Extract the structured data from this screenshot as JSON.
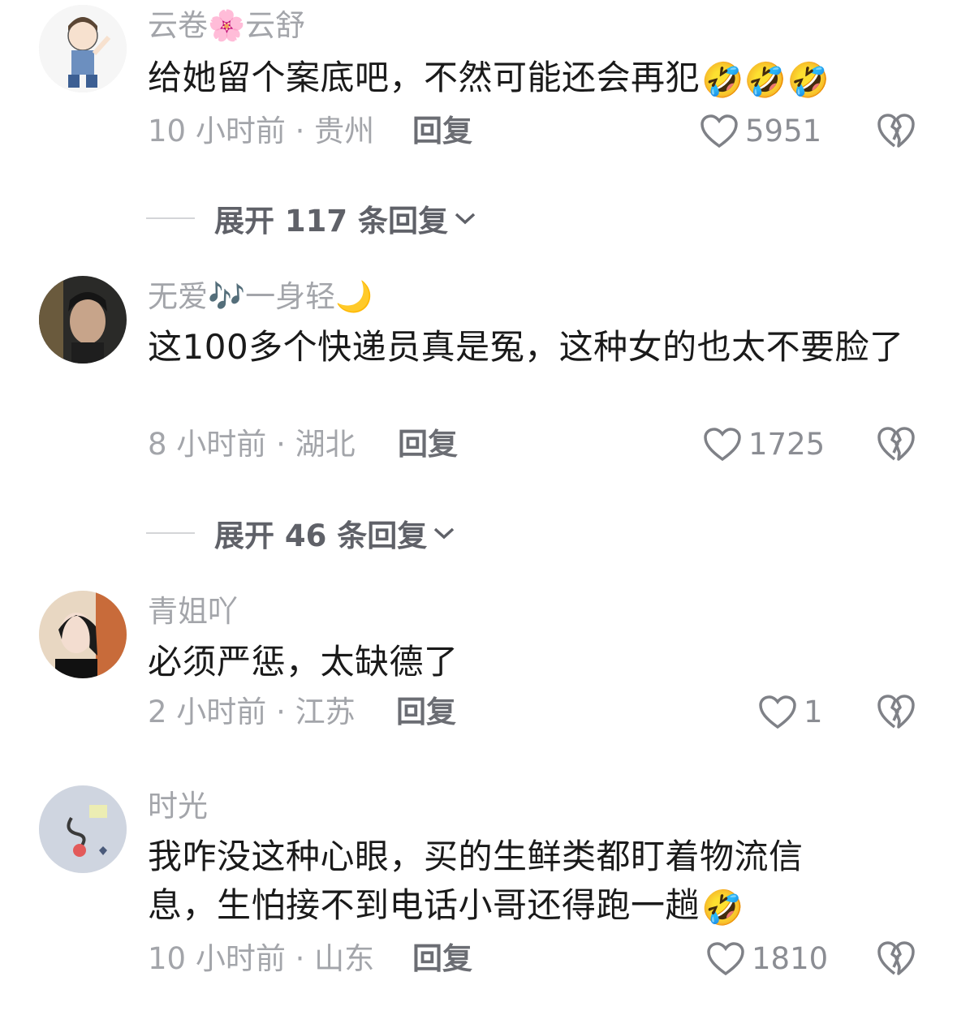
{
  "comments": [
    {
      "username": "云卷🌸云舒",
      "text": "给她留个案底吧，不然可能还会再犯",
      "emoji": "🤣🤣🤣",
      "meta": "10 小时前 · 贵州",
      "reply_label": "回复",
      "likes": "5951"
    },
    {
      "username": "无爱🎶一身轻🌙",
      "text": "这100多个快递员真是冤，这种女的也太不要脸了",
      "meta": "8 小时前 · 湖北",
      "reply_label": "回复",
      "likes": "1725"
    },
    {
      "username": "青姐吖",
      "text": "必须严惩，太缺德了",
      "meta": "2 小时前 · 江苏",
      "reply_label": "回复",
      "likes": "1"
    },
    {
      "username": "时光",
      "text": "我咋没这种心眼，买的生鲜类都盯着物流信息，生怕接不到电话小哥还得跑一趟",
      "emoji": "🤣",
      "meta": "10 小时前 · 山东",
      "reply_label": "回复",
      "likes": "1810"
    }
  ],
  "expand": [
    {
      "label": "展开 117 条回复"
    },
    {
      "label": "展开 46 条回复"
    }
  ],
  "icons": {
    "like": "heart-outline-icon",
    "dislike": "broken-heart-icon",
    "expand": "chevron-down-icon"
  }
}
